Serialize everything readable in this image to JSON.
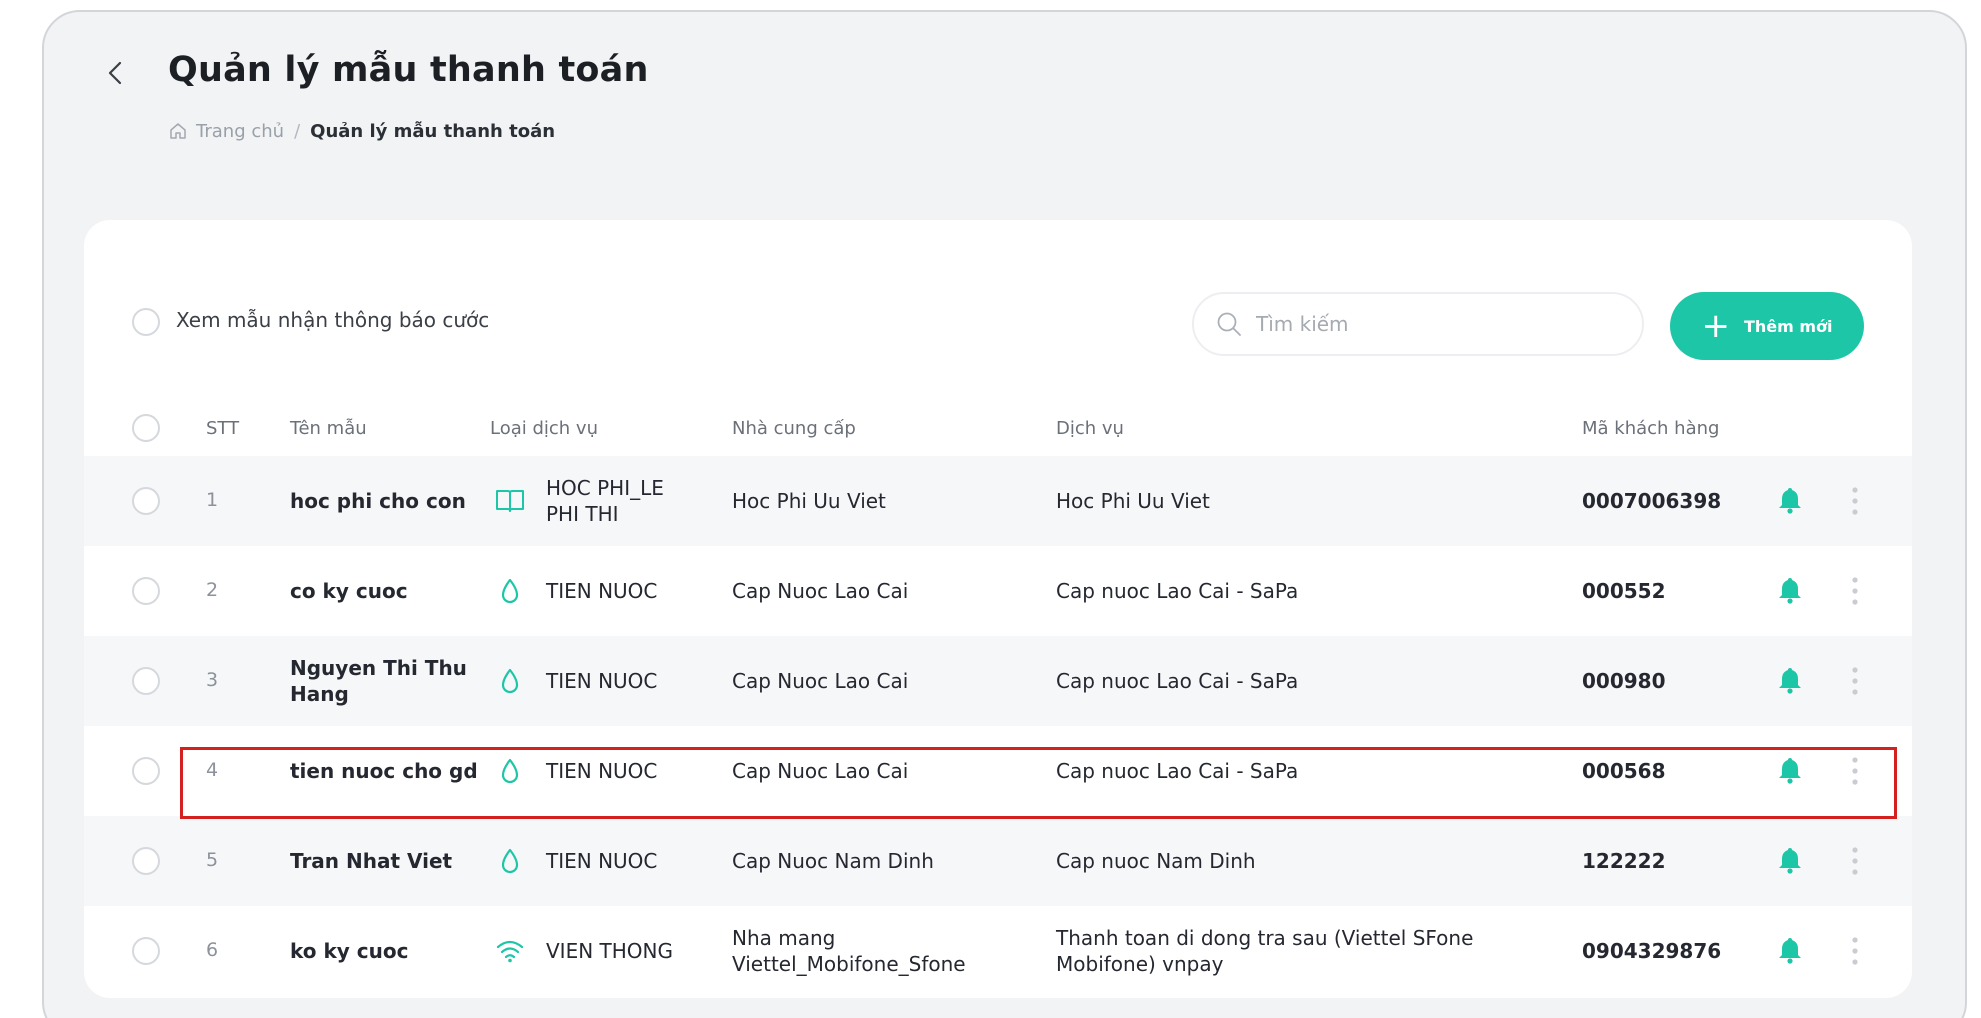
{
  "page": {
    "title": "Quản lý mẫu thanh toán",
    "breadcrumb": {
      "home": "Trang chủ",
      "separator": "/",
      "current": "Quản lý mẫu thanh toán"
    }
  },
  "toolbar": {
    "filter_label": "Xem mẫu nhận thông báo cước",
    "search_placeholder": "Tìm kiếm",
    "add_label": "Thêm mới",
    "add_icon": "+"
  },
  "table": {
    "headers": {
      "stt": "STT",
      "name": "Tên mẫu",
      "type": "Loại dịch vụ",
      "provider": "Nhà cung cấp",
      "service": "Dịch vụ",
      "code": "Mã khách hàng"
    },
    "rows": [
      {
        "stt": "1",
        "name": "hoc phi cho con",
        "icon": "book-icon",
        "type": "HOC PHI_LE PHI THI",
        "provider": "Hoc Phi Uu Viet",
        "service": "Hoc Phi Uu Viet",
        "code": "0007006398"
      },
      {
        "stt": "2",
        "name": "co ky cuoc",
        "icon": "water-drop-icon",
        "type": "TIEN NUOC",
        "provider": "Cap Nuoc Lao Cai",
        "service": "Cap nuoc Lao Cai - SaPa",
        "code": "000552"
      },
      {
        "stt": "3",
        "name": "Nguyen Thi Thu Hang",
        "icon": "water-drop-icon",
        "type": "TIEN NUOC",
        "provider": "Cap Nuoc Lao Cai",
        "service": "Cap nuoc Lao Cai - SaPa",
        "code": "000980"
      },
      {
        "stt": "4",
        "name": "tien nuoc cho gd",
        "icon": "water-drop-icon",
        "type": "TIEN NUOC",
        "provider": "Cap Nuoc Lao Cai",
        "service": "Cap nuoc Lao Cai - SaPa",
        "code": "000568"
      },
      {
        "stt": "5",
        "name": "Tran Nhat Viet",
        "icon": "water-drop-icon",
        "type": "TIEN NUOC",
        "provider": "Cap Nuoc Nam Dinh",
        "service": "Cap nuoc Nam Dinh",
        "code": "122222"
      },
      {
        "stt": "6",
        "name": "ko ky cuoc",
        "icon": "wifi-icon",
        "type": "VIEN THONG",
        "provider": "Nha mang Viettel_Mobifone_Sfone",
        "service": "Thanh toan di dong tra sau (Viettel SFone Mobifone) vnpay",
        "code": "0904329876"
      }
    ]
  },
  "colors": {
    "accent": "#1ec6a8",
    "highlight_border": "#d52020",
    "panel_bg": "#f2f3f5"
  }
}
